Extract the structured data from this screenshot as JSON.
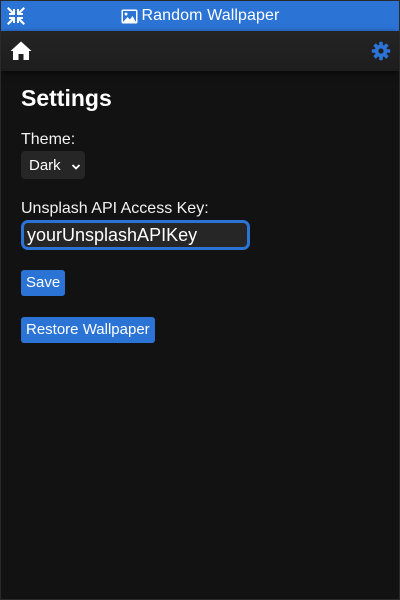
{
  "app": {
    "title": "Random Wallpaper",
    "accent_color": "#2b74d6",
    "background_color": "#121212"
  },
  "titlebar": {
    "left_icon": "shrink-arrows-icon",
    "title_icon": "image-icon"
  },
  "navbar": {
    "left_icon": "home-icon",
    "right_icon": "gear-icon"
  },
  "settings": {
    "heading": "Settings",
    "theme": {
      "label": "Theme:",
      "selected": "Dark"
    },
    "api_key": {
      "label": "Unsplash API Access Key:",
      "value": "yourUnsplashAPIKey"
    },
    "save_label": "Save",
    "restore_label": "Restore Wallpaper"
  }
}
